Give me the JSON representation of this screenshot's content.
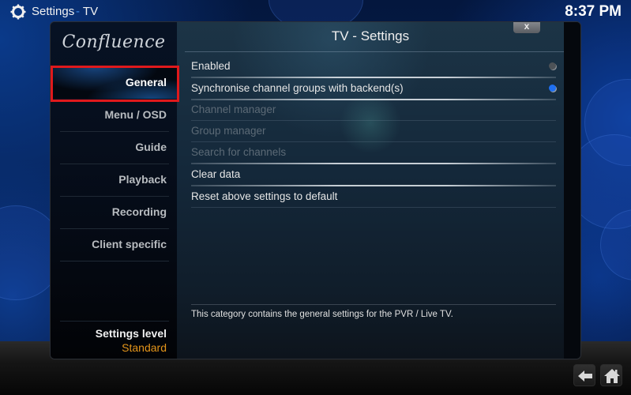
{
  "topbar": {
    "icon": "gear-icon",
    "title": "Settings",
    "subtitle_dash": "-",
    "subtitle": "TV",
    "clock": "8:37 PM"
  },
  "dialog": {
    "logo": "Confluence",
    "title": "TV - Settings",
    "close_label": "x",
    "categories": [
      {
        "label": "General",
        "selected": true
      },
      {
        "label": "Menu / OSD",
        "selected": false
      },
      {
        "label": "Guide",
        "selected": false
      },
      {
        "label": "Playback",
        "selected": false
      },
      {
        "label": "Recording",
        "selected": false
      },
      {
        "label": "Client specific",
        "selected": false
      }
    ],
    "settings_level": {
      "label": "Settings level",
      "value": "Standard"
    },
    "settings": [
      {
        "label": "Enabled",
        "enabled": true,
        "toggle": "off"
      },
      {
        "label": "Synchronise channel groups with backend(s)",
        "enabled": true,
        "toggle": "on"
      },
      {
        "label": "Channel manager",
        "enabled": false
      },
      {
        "label": "Group manager",
        "enabled": false
      },
      {
        "label": "Search for channels",
        "enabled": false
      },
      {
        "label": "Clear data",
        "enabled": true
      },
      {
        "label": "Reset above settings to default",
        "enabled": true
      }
    ],
    "description": "This category contains the general settings for the PVR / Live TV."
  },
  "nav": {
    "back_icon": "back-arrow-icon",
    "home_icon": "home-icon"
  },
  "colors": {
    "selection_outline": "#e0191c",
    "accent_orange": "#e4951a",
    "toggle_on": "#1f6ff0"
  }
}
